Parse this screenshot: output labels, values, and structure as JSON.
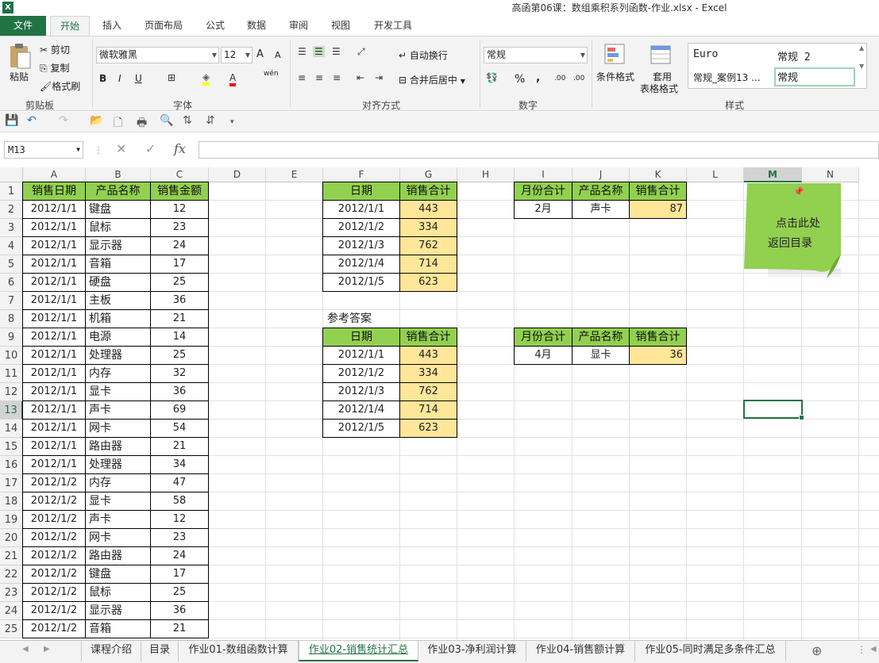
{
  "window": {
    "app_icon": "X",
    "title": "高函第06课：数组乘积系列函数-作业.xlsx - Excel"
  },
  "ribbon_tabs": [
    "文件",
    "开始",
    "插入",
    "页面布局",
    "公式",
    "数据",
    "审阅",
    "视图",
    "开发工具"
  ],
  "ribbon": {
    "clipboard": {
      "paste": "粘贴",
      "cut": "剪切",
      "copy": "复制",
      "format_painter": "格式刷",
      "label": "剪贴板"
    },
    "font": {
      "name": "微软雅黑",
      "size": "12",
      "bold": "B",
      "italic": "I",
      "underline": "U",
      "label": "字体",
      "grow": "A",
      "shrink": "A",
      "phonetic": "wén"
    },
    "alignment": {
      "wrap": "自动换行",
      "merge": "合并后居中",
      "label": "对齐方式"
    },
    "number": {
      "format": "常规",
      "label": "数字",
      "percent": "%",
      "comma": ",",
      "inc_dec": ".00",
      "dec_dec": ".00"
    },
    "styles": {
      "conditional": "条件格式",
      "table_format_1": "套用",
      "table_format_2": "表格格式",
      "label": "样式",
      "gallery": [
        "Euro",
        "常规 2",
        "常规_案例13 ...",
        "常规"
      ]
    }
  },
  "formula_bar": {
    "name_box": "M13",
    "fx": "fx",
    "value": ""
  },
  "columns": [
    "A",
    "B",
    "C",
    "D",
    "E",
    "F",
    "G",
    "H",
    "I",
    "J",
    "K",
    "L",
    "M",
    "N"
  ],
  "selected_column": "M",
  "selected_row": 13,
  "table_main": {
    "headers": [
      "销售日期",
      "产品名称",
      "销售金额"
    ],
    "rows": [
      [
        "2012/1/1",
        "键盘",
        "12"
      ],
      [
        "2012/1/1",
        "鼠标",
        "23"
      ],
      [
        "2012/1/1",
        "显示器",
        "24"
      ],
      [
        "2012/1/1",
        "音箱",
        "17"
      ],
      [
        "2012/1/1",
        "硬盘",
        "25"
      ],
      [
        "2012/1/1",
        "主板",
        "36"
      ],
      [
        "2012/1/1",
        "机箱",
        "21"
      ],
      [
        "2012/1/1",
        "电源",
        "14"
      ],
      [
        "2012/1/1",
        "处理器",
        "25"
      ],
      [
        "2012/1/1",
        "内存",
        "32"
      ],
      [
        "2012/1/1",
        "显卡",
        "36"
      ],
      [
        "2012/1/1",
        "声卡",
        "69"
      ],
      [
        "2012/1/1",
        "网卡",
        "54"
      ],
      [
        "2012/1/1",
        "路由器",
        "21"
      ],
      [
        "2012/1/1",
        "处理器",
        "34"
      ],
      [
        "2012/1/2",
        "内存",
        "47"
      ],
      [
        "2012/1/2",
        "显卡",
        "58"
      ],
      [
        "2012/1/2",
        "声卡",
        "12"
      ],
      [
        "2012/1/2",
        "网卡",
        "23"
      ],
      [
        "2012/1/2",
        "路由器",
        "24"
      ],
      [
        "2012/1/2",
        "键盘",
        "17"
      ],
      [
        "2012/1/2",
        "鼠标",
        "25"
      ],
      [
        "2012/1/2",
        "显示器",
        "36"
      ],
      [
        "2012/1/2",
        "音箱",
        "21"
      ]
    ]
  },
  "table_daily": {
    "headers": [
      "日期",
      "销售合计"
    ],
    "rows": [
      [
        "2012/1/1",
        "443"
      ],
      [
        "2012/1/2",
        "334"
      ],
      [
        "2012/1/3",
        "762"
      ],
      [
        "2012/1/4",
        "714"
      ],
      [
        "2012/1/5",
        "623"
      ]
    ]
  },
  "answer_label": "参考答案",
  "table_answer": {
    "headers": [
      "日期",
      "销售合计"
    ],
    "rows": [
      [
        "2012/1/1",
        "443"
      ],
      [
        "2012/1/2",
        "334"
      ],
      [
        "2012/1/3",
        "762"
      ],
      [
        "2012/1/4",
        "714"
      ],
      [
        "2012/1/5",
        "623"
      ]
    ]
  },
  "table_month1": {
    "headers": [
      "月份合计",
      "产品名称",
      "销售合计"
    ],
    "row": [
      "2月",
      "声卡",
      "87"
    ]
  },
  "table_month2": {
    "headers": [
      "月份合计",
      "产品名称",
      "销售合计"
    ],
    "row": [
      "4月",
      "显卡",
      "36"
    ]
  },
  "sticky_note": {
    "line1": "点击此处",
    "line2": "返回目录"
  },
  "sheet_tabs": [
    "课程介绍",
    "目录",
    "作业01-数组函数计算",
    "作业02-销售统计汇总",
    "作业03-净利润计算",
    "作业04-销售额计算",
    "作业05-同时满足多条件汇总"
  ],
  "active_sheet": "作业02-销售统计汇总",
  "colors": {
    "excel_green": "#217346",
    "header_green": "#92d050",
    "value_yellow": "#ffe699",
    "note_green": "#92d050"
  }
}
